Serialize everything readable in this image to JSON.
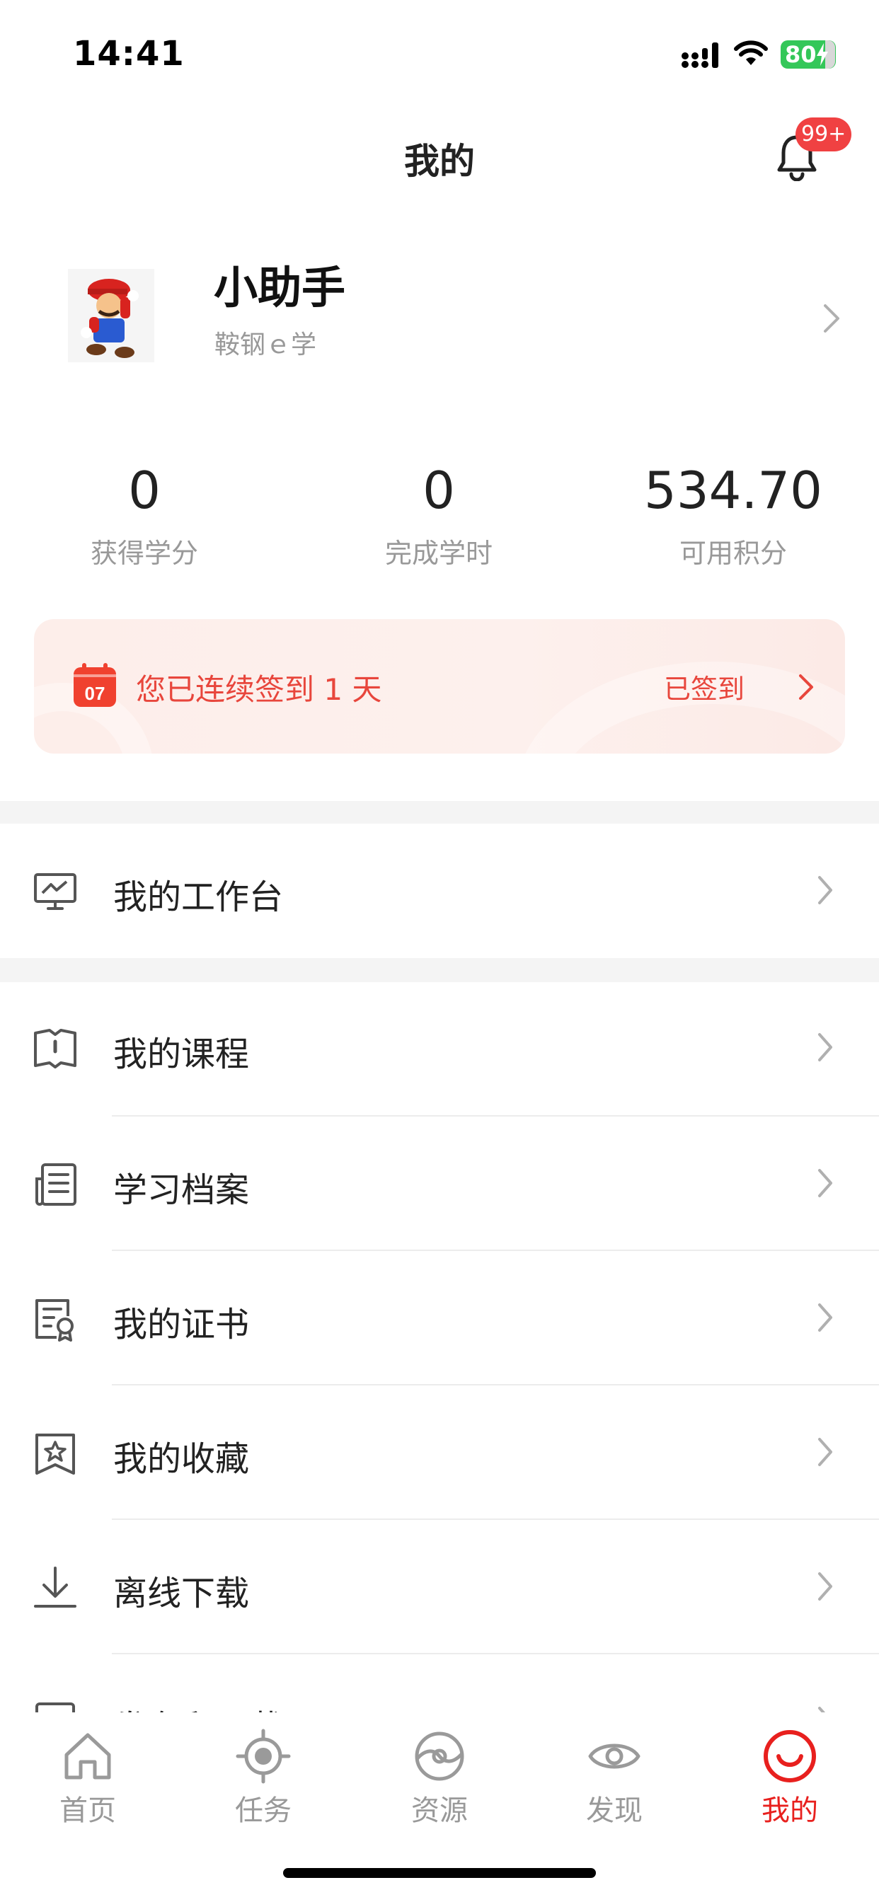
{
  "status_bar": {
    "time": "14:41",
    "battery": "80"
  },
  "header": {
    "title": "我的",
    "badge": "99+"
  },
  "profile": {
    "name": "小助手",
    "org": "鞍钢ｅ学"
  },
  "stats": [
    {
      "value": "0",
      "label": "获得学分"
    },
    {
      "value": "0",
      "label": "完成学时"
    },
    {
      "value": "534.70",
      "label": "可用积分"
    }
  ],
  "signin": {
    "calendar_day": "07",
    "text": "您已连续签到 1 天",
    "status": "已签到"
  },
  "menu": {
    "workbench": "我的工作台",
    "items": [
      "我的课程",
      "学习档案",
      "我的证书",
      "我的收藏",
      "离线下载",
      "发布和下载"
    ]
  },
  "tabs": [
    "首页",
    "任务",
    "资源",
    "发现",
    "我的"
  ],
  "colors": {
    "accent": "#e8201e",
    "signin_bg": "#fdeeea",
    "badge": "#f04142"
  }
}
